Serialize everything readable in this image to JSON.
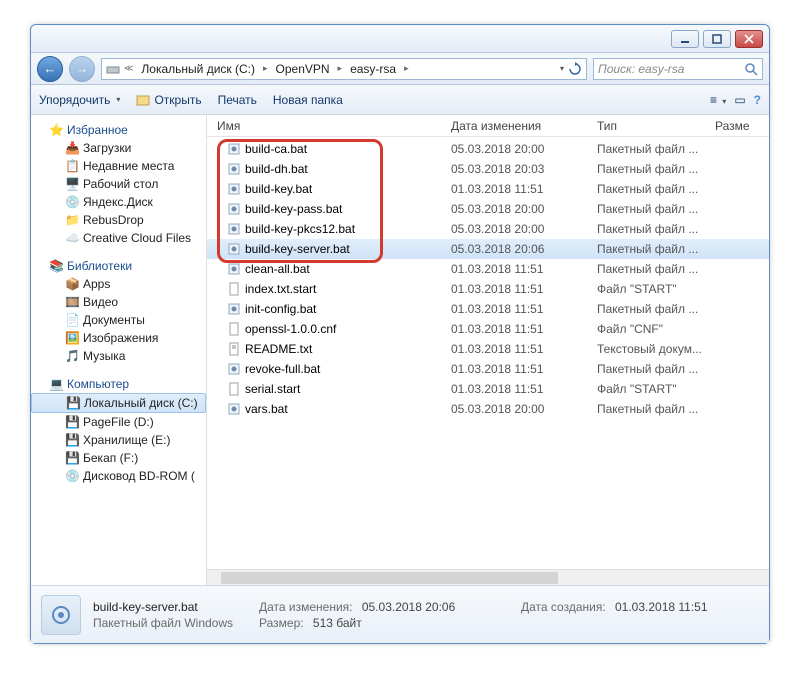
{
  "breadcrumb": {
    "seg1": "Локальный диск (C:)",
    "seg2": "OpenVPN",
    "seg3": "easy-rsa"
  },
  "search": {
    "placeholder": "Поиск: easy-rsa"
  },
  "toolbar": {
    "organize": "Упорядочить",
    "open": "Открыть",
    "print": "Печать",
    "newfolder": "Новая папка"
  },
  "columns": {
    "name": "Имя",
    "date": "Дата изменения",
    "type": "Тип",
    "size": "Разме"
  },
  "sidebar": {
    "favorites": "Избранное",
    "downloads": "Загрузки",
    "recent": "Недавние места",
    "desktop": "Рабочий стол",
    "yandex": "Яндекс.Диск",
    "rebus": "RebusDrop",
    "creative": "Creative Cloud Files",
    "libraries": "Библиотеки",
    "apps": "Apps",
    "video": "Видео",
    "documents": "Документы",
    "images": "Изображения",
    "music": "Музыка",
    "computer": "Компьютер",
    "localc": "Локальный диск (C:)",
    "pagefile": "PageFile (D:)",
    "storage": "Хранилище (E:)",
    "backup": "Бекап (F:)",
    "bdrom": "Дисковод BD-ROM ("
  },
  "files": [
    {
      "name": "build-ca.bat",
      "date": "05.03.2018 20:00",
      "type": "Пакетный файл ..."
    },
    {
      "name": "build-dh.bat",
      "date": "05.03.2018 20:03",
      "type": "Пакетный файл ..."
    },
    {
      "name": "build-key.bat",
      "date": "01.03.2018 11:51",
      "type": "Пакетный файл ..."
    },
    {
      "name": "build-key-pass.bat",
      "date": "05.03.2018 20:00",
      "type": "Пакетный файл ..."
    },
    {
      "name": "build-key-pkcs12.bat",
      "date": "05.03.2018 20:00",
      "type": "Пакетный файл ..."
    },
    {
      "name": "build-key-server.bat",
      "date": "05.03.2018 20:06",
      "type": "Пакетный файл ...",
      "selected": true
    },
    {
      "name": "clean-all.bat",
      "date": "01.03.2018 11:51",
      "type": "Пакетный файл ..."
    },
    {
      "name": "index.txt.start",
      "date": "01.03.2018 11:51",
      "type": "Файл \"START\""
    },
    {
      "name": "init-config.bat",
      "date": "01.03.2018 11:51",
      "type": "Пакетный файл ..."
    },
    {
      "name": "openssl-1.0.0.cnf",
      "date": "01.03.2018 11:51",
      "type": "Файл \"CNF\""
    },
    {
      "name": "README.txt",
      "date": "01.03.2018 11:51",
      "type": "Текстовый докум..."
    },
    {
      "name": "revoke-full.bat",
      "date": "01.03.2018 11:51",
      "type": "Пакетный файл ..."
    },
    {
      "name": "serial.start",
      "date": "01.03.2018 11:51",
      "type": "Файл \"START\""
    },
    {
      "name": "vars.bat",
      "date": "05.03.2018 20:00",
      "type": "Пакетный файл ..."
    }
  ],
  "status": {
    "filename": "build-key-server.bat",
    "filetype": "Пакетный файл Windows",
    "mod_label": "Дата изменения:",
    "mod_value": "05.03.2018 20:06",
    "size_label": "Размер:",
    "size_value": "513 байт",
    "created_label": "Дата создания:",
    "created_value": "01.03.2018 11:51"
  }
}
